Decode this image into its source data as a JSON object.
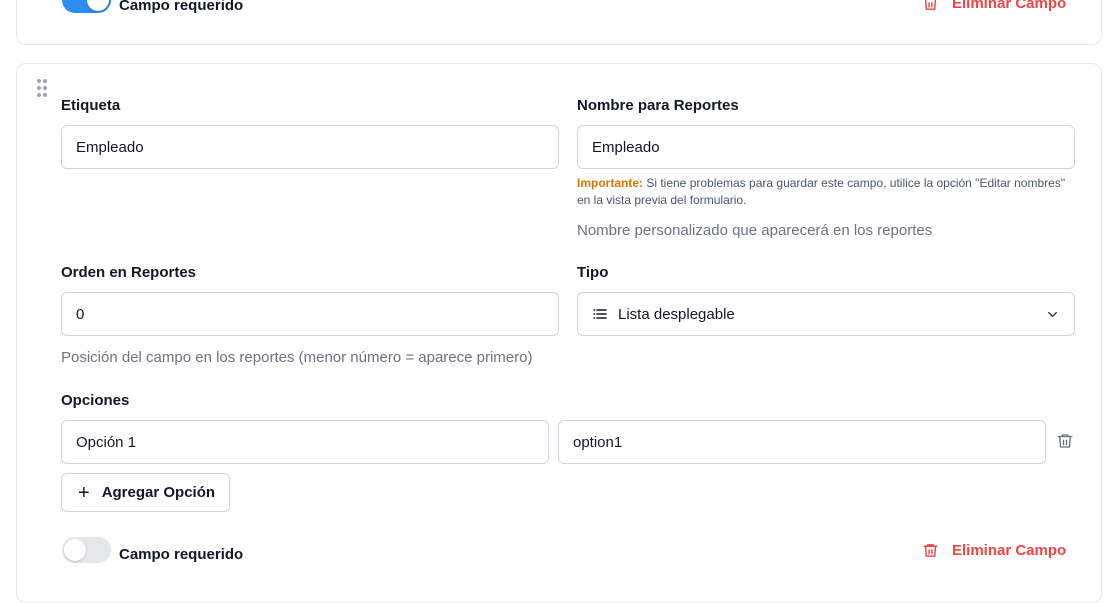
{
  "top_card": {
    "required_toggle": {
      "label": "Campo requerido",
      "on": true
    },
    "delete_label": "Eliminar Campo"
  },
  "field": {
    "label": {
      "title": "Etiqueta",
      "value": "Empleado"
    },
    "report_name": {
      "title": "Nombre para Reportes",
      "value": "Empleado",
      "important_prefix": "Importante:",
      "important_text": " Si tiene problemas para guardar este campo, utilice la opción \"Editar nombres\" en la vista previa del formulario.",
      "hint": "Nombre personalizado que aparecerá en los reportes"
    },
    "report_order": {
      "title": "Orden en Reportes",
      "value": "0",
      "hint": "Posición del campo en los reportes (menor número = aparece primero)"
    },
    "type": {
      "title": "Tipo",
      "value": "Lista desplegable",
      "icon": "list-icon"
    },
    "options": {
      "title": "Opciones",
      "items": [
        {
          "label": "Opción 1",
          "value": "option1"
        }
      ],
      "add_label": "Agregar Opción"
    },
    "required_toggle": {
      "label": "Campo requerido",
      "on": false
    },
    "delete_label": "Eliminar Campo"
  },
  "colors": {
    "accent": "#2d8cf0",
    "danger": "#ef4444",
    "warning": "#d97706",
    "border": "#e5e7eb"
  }
}
